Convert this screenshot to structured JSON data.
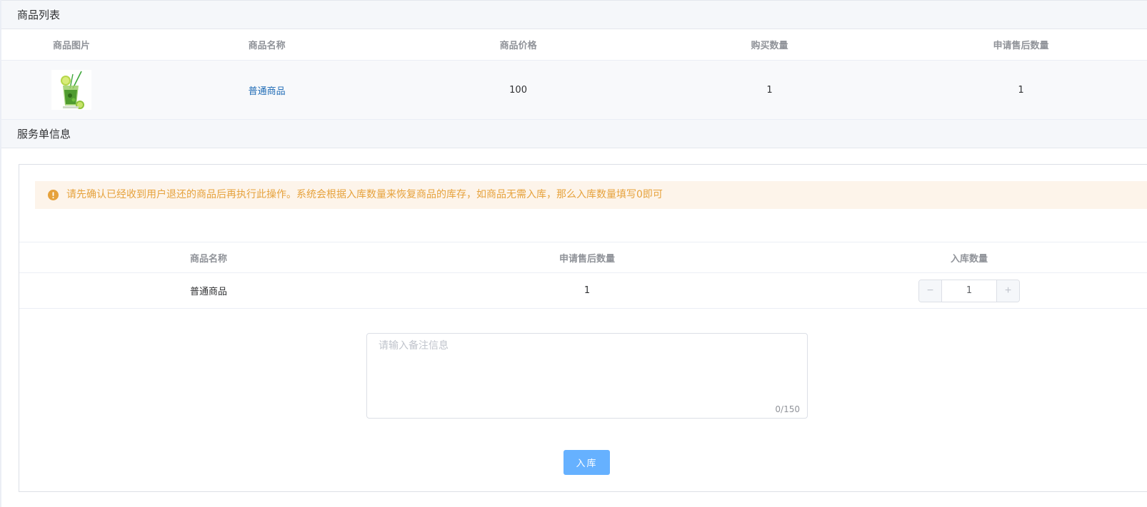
{
  "goods_list": {
    "title": "商品列表",
    "columns": [
      "商品图片",
      "商品名称",
      "商品价格",
      "购买数量",
      "申请售后数量"
    ],
    "rows": [
      {
        "image_icon": "cocktail-product-thumbnail",
        "name": "普通商品",
        "price": "100",
        "buy_qty": "1",
        "after_sale_qty": "1"
      }
    ]
  },
  "service_info": {
    "title": "服务单信息",
    "alert": {
      "icon": "warning-icon",
      "text": "请先确认已经收到用户退还的商品后再执行此操作。系统会根据入库数量来恢复商品的库存，如商品无需入库，那么入库数量填写0即可"
    },
    "table": {
      "columns": [
        "商品名称",
        "申请售后数量",
        "入库数量"
      ],
      "rows": [
        {
          "name": "普通商品",
          "after_sale_qty": "1",
          "stock_in_qty": "1"
        }
      ]
    },
    "stepper": {
      "minus": "−",
      "plus": "+"
    },
    "remark": {
      "placeholder": "请输入备注信息",
      "counter": "0/150"
    },
    "submit_label": "入库"
  },
  "colors": {
    "link": "#1f6bb5",
    "alert_bg": "#fdf4ea",
    "alert_text": "#e6a23c",
    "primary_button": "#66b1ff"
  }
}
